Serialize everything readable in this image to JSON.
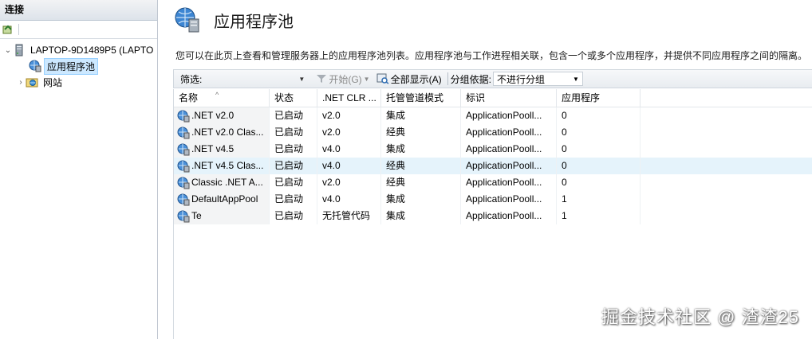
{
  "connections": {
    "header": "连接",
    "tree": [
      {
        "label": "LAPTOP-9D1489P5 (LAPTO",
        "expanded": true,
        "icon": "server-icon"
      },
      {
        "label": "应用程序池",
        "selected": true,
        "icon": "app-pool-icon"
      },
      {
        "label": "网站",
        "icon": "sites-icon"
      }
    ]
  },
  "page": {
    "title": "应用程序池",
    "description": "您可以在此页上查看和管理服务器上的应用程序池列表。应用程序池与工作进程相关联，包含一个或多个应用程序，并提供不同应用程序之间的隔离。"
  },
  "filterbar": {
    "filter_label": "筛选:",
    "filter_value": "",
    "start_label": "开始(G)",
    "show_all_label": "全部显示(A)",
    "group_by_label": "分组依据:",
    "group_by_value": "不进行分组"
  },
  "table": {
    "columns": [
      "名称",
      "状态",
      ".NET CLR ...",
      "托管管道模式",
      "标识",
      "应用程序"
    ],
    "rows": [
      {
        "name": ".NET v2.0",
        "state": "已启动",
        "clr": "v2.0",
        "pipeline": "集成",
        "identity": "ApplicationPooll...",
        "apps": "0"
      },
      {
        "name": ".NET v2.0 Clas...",
        "state": "已启动",
        "clr": "v2.0",
        "pipeline": "经典",
        "identity": "ApplicationPooll...",
        "apps": "0"
      },
      {
        "name": ".NET v4.5",
        "state": "已启动",
        "clr": "v4.0",
        "pipeline": "集成",
        "identity": "ApplicationPooll...",
        "apps": "0"
      },
      {
        "name": ".NET v4.5 Clas...",
        "state": "已启动",
        "clr": "v4.0",
        "pipeline": "经典",
        "identity": "ApplicationPooll...",
        "apps": "0",
        "selected": true
      },
      {
        "name": "Classic .NET A...",
        "state": "已启动",
        "clr": "v2.0",
        "pipeline": "经典",
        "identity": "ApplicationPooll...",
        "apps": "0"
      },
      {
        "name": "DefaultAppPool",
        "state": "已启动",
        "clr": "v4.0",
        "pipeline": "集成",
        "identity": "ApplicationPooll...",
        "apps": "1"
      },
      {
        "name": "Te",
        "state": "已启动",
        "clr": "无托管代码",
        "pipeline": "集成",
        "identity": "ApplicationPooll...",
        "apps": "1"
      }
    ]
  },
  "watermark": "掘金技术社区 @ 渣渣25"
}
